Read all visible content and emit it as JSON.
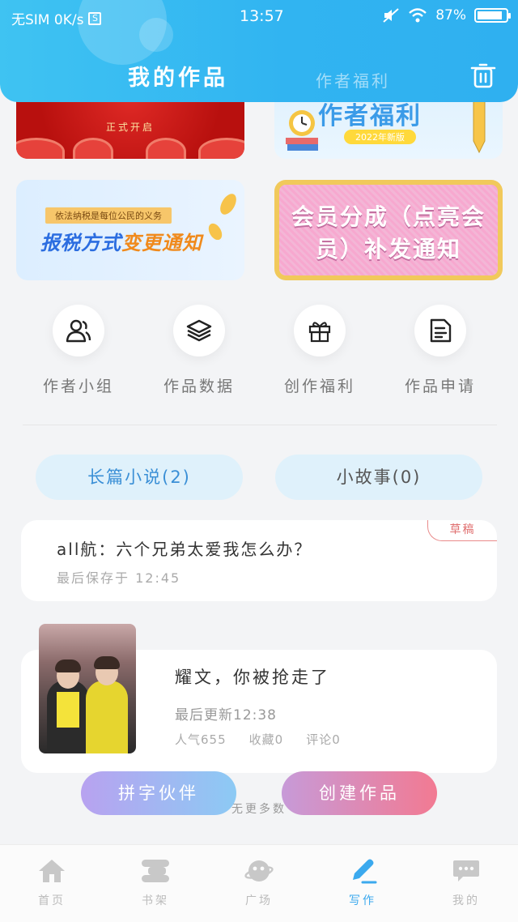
{
  "status_bar": {
    "carrier": "无SIM 0K/s",
    "s_badge": "S",
    "time": "13:57",
    "battery": "87%",
    "battery_level": 0.87
  },
  "header": {
    "tab_active": "我的作品",
    "tab_inactive": "作者福利",
    "trash_icon": "trash-icon"
  },
  "banners": {
    "b1_sub": "正式开启",
    "b2_title": "作者福利",
    "b2_year": "2022年新版",
    "b3_tag": "依法纳税是每位公民的义务",
    "b3_title_a": "报税方式",
    "b3_title_b": "变更通知",
    "b4_text": "会员分成（点亮会员）补发通知"
  },
  "quick_links": [
    {
      "label": "作者小组",
      "icon": "user-group-icon"
    },
    {
      "label": "作品数据",
      "icon": "layers-icon"
    },
    {
      "label": "创作福利",
      "icon": "gift-icon"
    },
    {
      "label": "作品申请",
      "icon": "document-icon"
    }
  ],
  "categories": {
    "novel": "长篇小说(2)",
    "story": "小故事(0)"
  },
  "draft": {
    "title": "all航：六个兄弟太爱我怎么办？",
    "saved": "最后保存于 12:45",
    "badge": "草稿"
  },
  "work": {
    "title": "耀文，你被抢走了",
    "updated": "最后更新12:38",
    "popularity": "人气655",
    "favorites": "收藏0",
    "comments": "评论0"
  },
  "footer_note": "无更多数",
  "buttons": {
    "partner": "拼字伙伴",
    "create": "创建作品"
  },
  "bottom_nav": [
    {
      "label": "首页",
      "icon": "home-icon"
    },
    {
      "label": "书架",
      "icon": "bookshelf-icon"
    },
    {
      "label": "广场",
      "icon": "planet-icon"
    },
    {
      "label": "写作",
      "icon": "pen-icon"
    },
    {
      "label": "我的",
      "icon": "chat-bubble-icon"
    }
  ],
  "colors": {
    "header_blue": "#31b4f1",
    "active_nav": "#3ba9ee",
    "draft_badge": "#e07070"
  }
}
